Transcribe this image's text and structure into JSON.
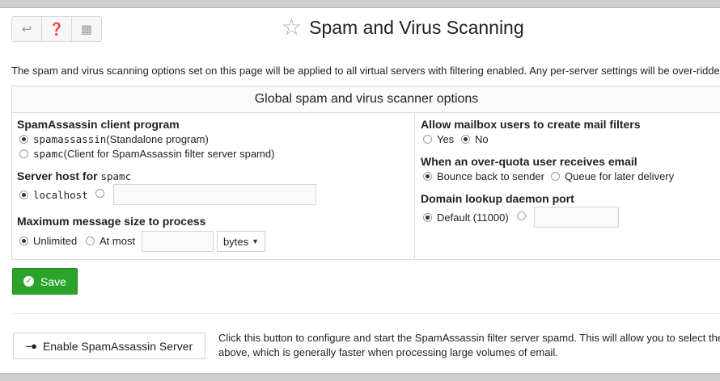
{
  "header": {
    "title": "Spam and Virus Scanning",
    "toolbar": [
      {
        "name": "back-icon",
        "glyph": "↩"
      },
      {
        "name": "help-icon",
        "glyph": "❓"
      },
      {
        "name": "grid-icon",
        "glyph": "▦"
      }
    ]
  },
  "intro": "The spam and virus scanning options set on this page will be applied to all virtual servers with filtering enabled. Any per-server settings will be over-ridden",
  "panel": {
    "title": "Global spam and virus scanner options",
    "left": {
      "client_program": {
        "label": "SpamAssassin client program",
        "option1_mono": "spamassassin",
        "option1_text": " (Standalone program)",
        "option2_mono": "spamc",
        "option2_text": " (Client for SpamAssassin filter server spamd)"
      },
      "server_host": {
        "label_text": "Server host for ",
        "label_mono": "spamc",
        "option1": "localhost",
        "input_value": ""
      },
      "max_size": {
        "label": "Maximum message size to process",
        "option1": "Unlimited",
        "option2": "At most",
        "input_value": "",
        "unit": "bytes"
      }
    },
    "right": {
      "mail_filters": {
        "label": "Allow mailbox users to create mail filters",
        "yes": "Yes",
        "no": "No"
      },
      "over_quota": {
        "label": "When an over-quota user receives email",
        "option1": "Bounce back to sender",
        "option2": "Queue for later delivery"
      },
      "lookup_port": {
        "label": "Domain lookup daemon port",
        "option1": "Default (11000)",
        "input_value": ""
      }
    }
  },
  "save_label": "Save",
  "enable": {
    "button_label": "Enable SpamAssassin Server",
    "desc_line1": "Click this button to configure and start the SpamAssassin filter server spamd. This will allow you to select the",
    "desc_line2": "above, which is generally faster when processing large volumes of email."
  },
  "colors": {
    "save_green": "#2aa32a"
  }
}
